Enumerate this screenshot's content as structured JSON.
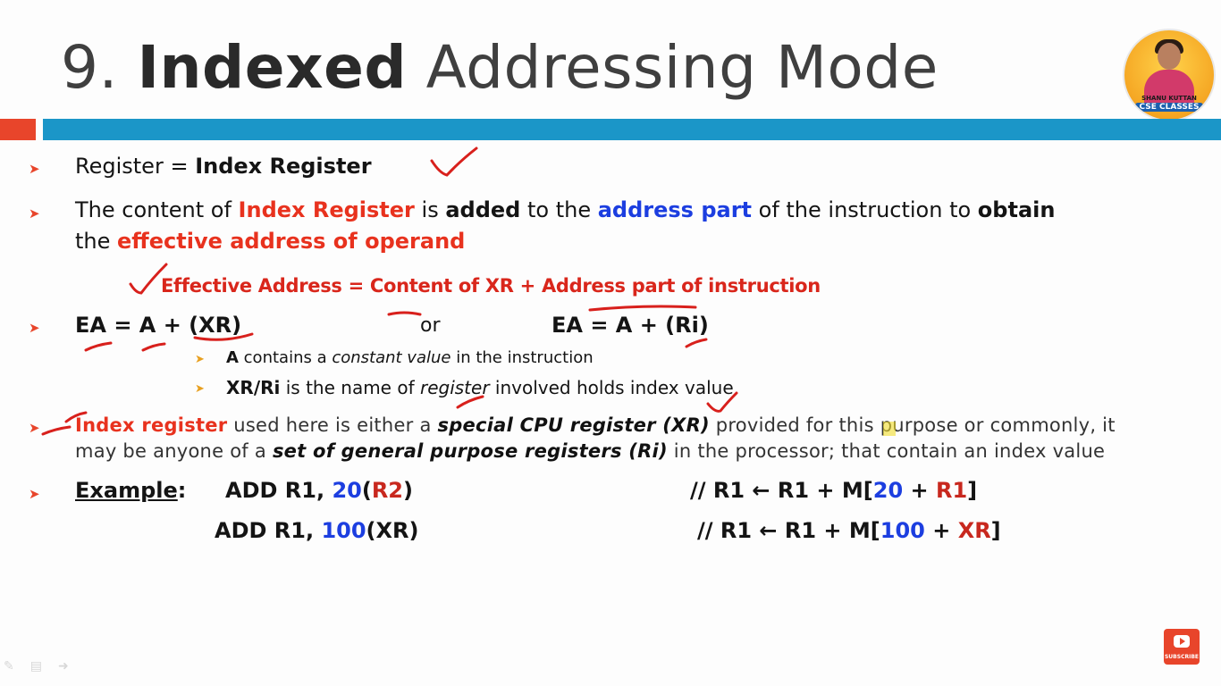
{
  "title": {
    "number": "9.",
    "bold_word": "Indexed",
    "rest": "Addressing Mode"
  },
  "logo": {
    "name": "SHANU KUTTAN",
    "brand": "CSE CLASSES"
  },
  "bullets": {
    "b1": {
      "pre": "Register = ",
      "bold": "Index Register"
    },
    "b2": {
      "t1": "The content of ",
      "t2": "Index Register",
      "t3": " is ",
      "t4": "added",
      "t5": " to the ",
      "t6": "address part",
      "t7": " of the instruction to ",
      "t8": "obtain",
      "t9": "the ",
      "t10": "effective address of operand"
    },
    "formula": "Effective Address = Content of XR + Address part of instruction",
    "b3": {
      "left": "EA = A + (XR)",
      "or": "or",
      "right": "EA = A + (Ri)"
    },
    "sub1": {
      "t1": "A",
      "t2": " contains a ",
      "t3": "constant value",
      "t4": " in the instruction"
    },
    "sub2": {
      "t1": "XR/Ri",
      "t2": " is the name of ",
      "t3": "register",
      "t4": " involved holds index value"
    },
    "b4": {
      "t1": "Index register",
      "t2": " used here is either a ",
      "t3": "special CPU register (XR)",
      "t4": " provided for this purpose or commonly, it",
      "t5": "may be anyone of a ",
      "t6": "set of general purpose registers (Ri)",
      "t7": " in the processor; that contain an index value"
    },
    "example": {
      "label": "Example",
      "colon": ":",
      "row1": {
        "instr_a": "ADD R1, ",
        "instr_b": "20",
        "instr_c": "(",
        "instr_d": "R2",
        "instr_e": ")",
        "cmt_a": "// R1 ← R1 + M[",
        "cmt_b": "20",
        "cmt_c": " + ",
        "cmt_d": "R1",
        "cmt_e": "]"
      },
      "row2": {
        "instr_a": "ADD R1, ",
        "instr_b": "100",
        "instr_c": "(XR)",
        "cmt_a": "// R1 ← R1 + M[",
        "cmt_b": "100",
        "cmt_c": " + ",
        "cmt_d": "XR",
        "cmt_e": "]"
      }
    }
  },
  "subscribe_label": "SUBSCRIBE",
  "colors": {
    "accent_orange": "#e8452b",
    "accent_blue": "#1b96c8",
    "text_red": "#e8321e",
    "text_blue": "#1c3ee0"
  },
  "icons": [
    "arrow-bullet-icon",
    "checkmark-icon",
    "subscribe-icon",
    "pen-tool-icon"
  ]
}
